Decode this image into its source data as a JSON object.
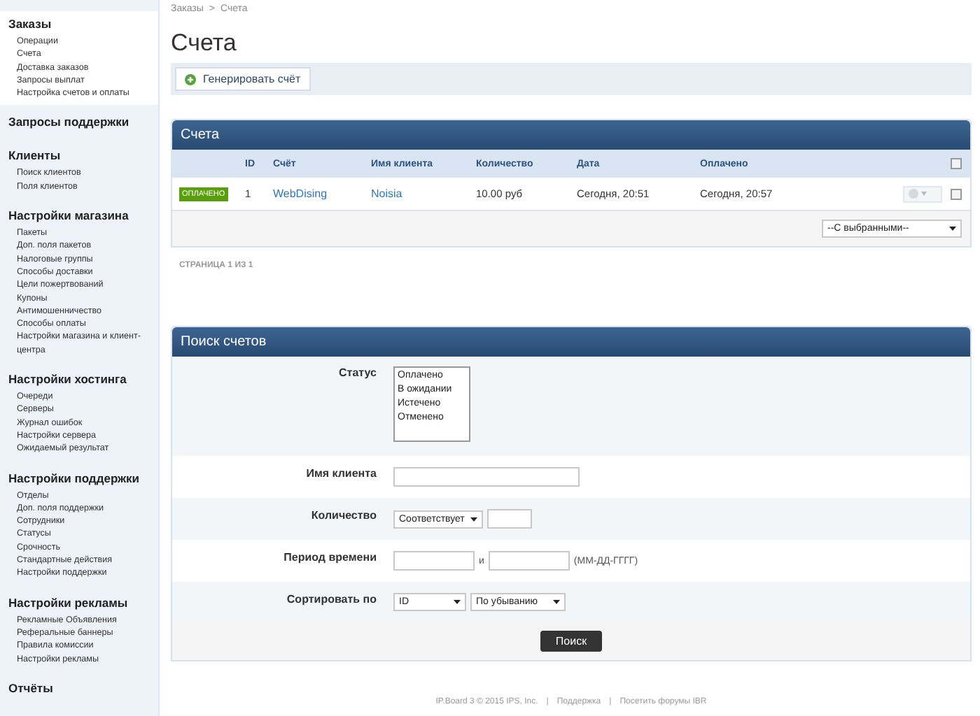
{
  "sidebar": {
    "groups": [
      {
        "title": "Заказы",
        "selected": true,
        "items": [
          "Операции",
          "Счета",
          "Доставка заказов",
          "Запросы выплат",
          "Настройка счетов и оплаты"
        ]
      },
      {
        "title": "Запросы поддержки",
        "selected": false
      },
      {
        "title": "Клиенты",
        "selected": false,
        "items": [
          "Поиск клиентов",
          "Поля клиентов"
        ]
      },
      {
        "title": "Настройки магазина",
        "selected": false,
        "items": [
          "Пакеты",
          "Доп. поля пакетов",
          "Налоговые группы",
          "Способы доставки",
          "Цели пожертвований",
          "Купоны",
          "Антимошенничество",
          "Способы оплаты",
          "Настройки магазина и клиент-центра"
        ]
      },
      {
        "title": "Настройки хостинга",
        "selected": false,
        "items": [
          "Очереди",
          "Серверы",
          "Журнал ошибок",
          "Настройки сервера",
          "Ожидаемый результат"
        ]
      },
      {
        "title": "Настройки поддержки",
        "selected": false,
        "items": [
          "Отделы",
          "Доп. поля поддержки",
          "Сотрудники",
          "Статусы",
          "Срочность",
          "Стандартные действия",
          "Настройки поддержки"
        ]
      },
      {
        "title": "Настройки рекламы",
        "selected": false,
        "items": [
          "Рекламные Объявления",
          "Реферальные баннеры",
          "Правила комиссии",
          "Настройки рекламы"
        ]
      },
      {
        "title": "Отчёты",
        "selected": false
      }
    ]
  },
  "breadcrumb": [
    "Заказы",
    ">",
    "Счета"
  ],
  "page_title": "Счета",
  "toolbar_button": "Генерировать счёт",
  "invoices": {
    "title": "Счета",
    "columns": [
      "ID",
      "Счёт",
      "Имя клиента",
      "Количество",
      "Дата",
      "Оплачено"
    ],
    "all_checked": false,
    "rows": [
      {
        "status": "ОПЛАЧЕНО",
        "id": "1",
        "invoice": "WebDising",
        "client": "Noisia",
        "amount": "10.00 руб",
        "date": "Сегодня, 20:51",
        "paid": "Сегодня, 20:57",
        "checked": false
      }
    ],
    "bulk_action": "--С выбранными--"
  },
  "pagination": "СТРАНИЦА 1 ИЗ 1",
  "search": {
    "title": "Поиск счетов",
    "fields": [
      {
        "kind": "listbox",
        "label": "Статус",
        "options": [
          "Оплачено",
          "В ожидании",
          "Истечено",
          "Отменено"
        ]
      },
      {
        "kind": "text",
        "label": "Имя клиента"
      },
      {
        "kind": "compare",
        "label": "Количество",
        "operator": "Соответствует"
      },
      {
        "kind": "daterange",
        "label": "Период времени",
        "joiner": "и",
        "hint": "(ММ-ДД-ГГГГ)"
      },
      {
        "kind": "sort",
        "label": "Сортировать по",
        "field": "ID",
        "order": "По убыванию"
      }
    ],
    "submit": "Поиск"
  },
  "footer": [
    "IP.Board 3 © 2015 IPS, Inc.",
    "|",
    "Поддержка",
    "|",
    "Посетить форумы IBR"
  ]
}
